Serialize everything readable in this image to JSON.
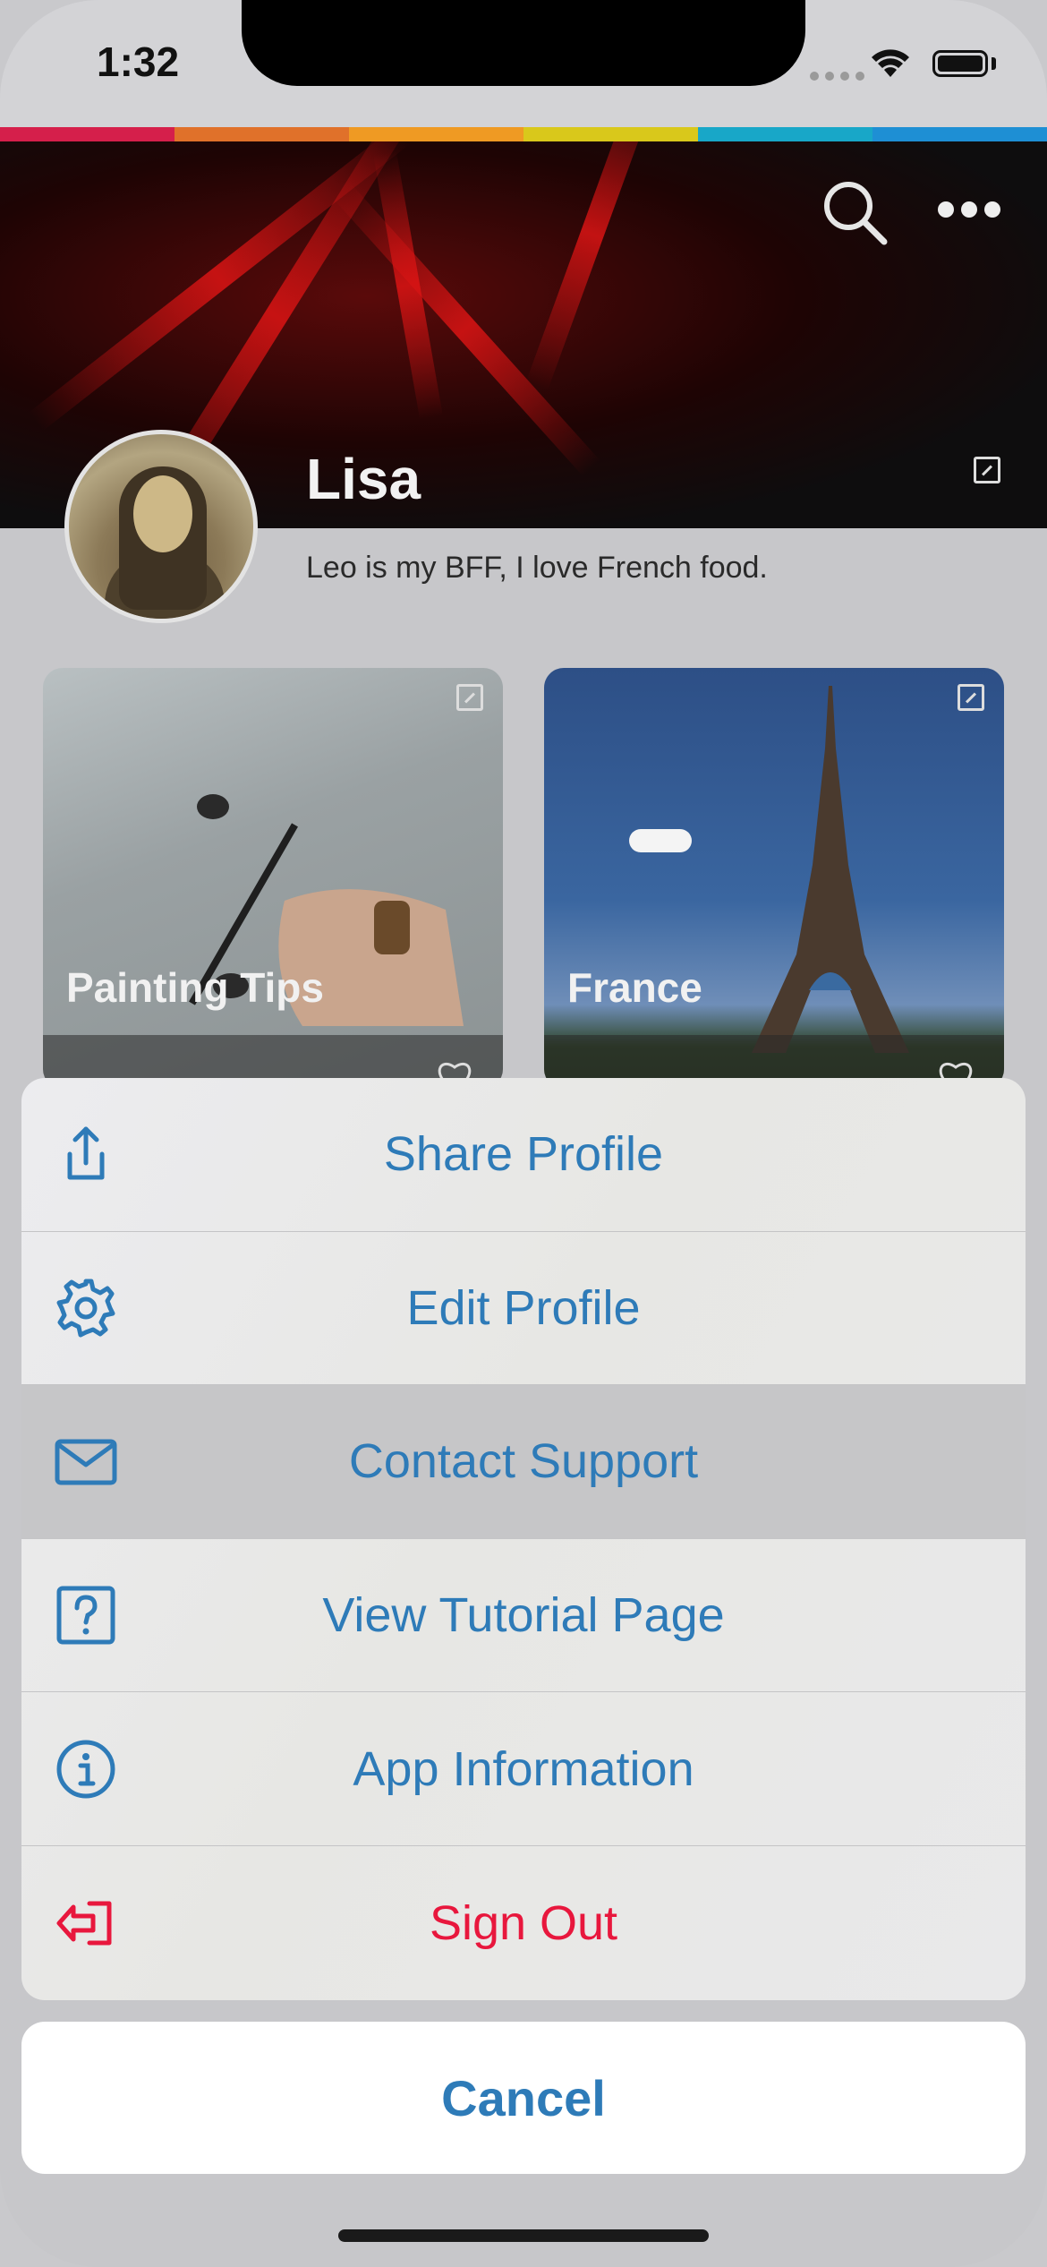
{
  "status_bar": {
    "time": "1:32"
  },
  "brand_colors": [
    "#d51f4b",
    "#e0712a",
    "#ef9a23",
    "#d9c81b",
    "#18a7c8",
    "#1e8fd4"
  ],
  "profile": {
    "name": "Lisa",
    "bio": "Leo is my BFF, I love French food."
  },
  "cards": [
    {
      "title": "Painting Tips"
    },
    {
      "title": "France"
    }
  ],
  "action_sheet": {
    "items": [
      {
        "label": "Share Profile",
        "icon": "share-icon"
      },
      {
        "label": "Edit Profile",
        "icon": "gear-icon"
      },
      {
        "label": "Contact Support",
        "icon": "mail-icon"
      },
      {
        "label": "View Tutorial Page",
        "icon": "help-icon"
      },
      {
        "label": "App Information",
        "icon": "info-icon"
      },
      {
        "label": "Sign Out",
        "icon": "sign-out-icon"
      }
    ],
    "cancel_label": "Cancel"
  },
  "colors": {
    "accent": "#2e7bb8",
    "destructive": "#e8173d"
  }
}
